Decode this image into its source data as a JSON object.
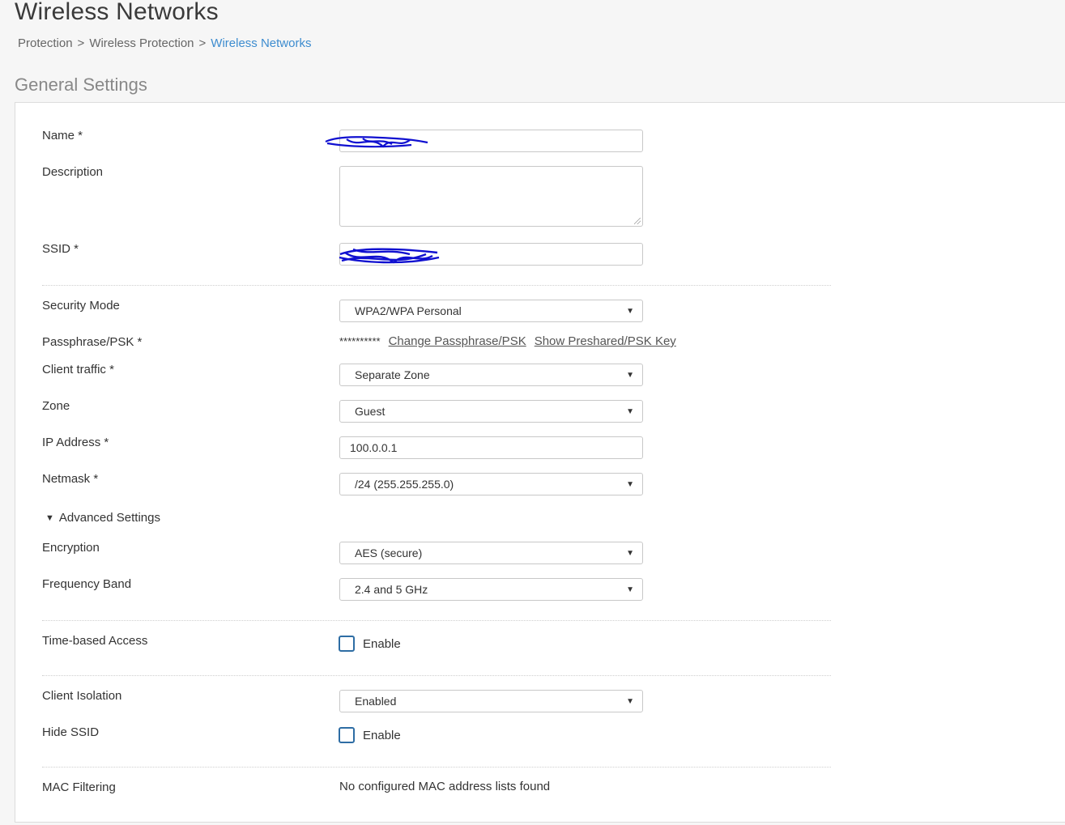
{
  "page": {
    "title": "Wireless Networks",
    "breadcrumb": [
      "Protection",
      "Wireless Protection",
      "Wireless Networks"
    ],
    "breadcrumb_sep": ">",
    "section_title": "General Settings"
  },
  "form": {
    "name": {
      "label": "Name *",
      "value": ""
    },
    "description": {
      "label": "Description",
      "value": ""
    },
    "ssid": {
      "label": "SSID *",
      "value": ""
    },
    "security_mode": {
      "label": "Security Mode",
      "value": "WPA2/WPA Personal"
    },
    "passphrase": {
      "label": "Passphrase/PSK *",
      "mask": "**********",
      "change_link": "Change Passphrase/PSK",
      "show_link": "Show Preshared/PSK Key"
    },
    "client_traffic": {
      "label": "Client traffic *",
      "value": "Separate Zone"
    },
    "zone": {
      "label": "Zone",
      "value": "Guest"
    },
    "ip_address": {
      "label": "IP Address *",
      "value": "100.0.0.1"
    },
    "netmask": {
      "label": "Netmask *",
      "value": "/24 (255.255.255.0)"
    },
    "advanced": {
      "label": "Advanced Settings",
      "toggle": "▼"
    },
    "encryption": {
      "label": "Encryption",
      "value": "AES (secure)"
    },
    "frequency_band": {
      "label": "Frequency Band",
      "value": "2.4 and 5 GHz"
    },
    "time_based_access": {
      "label": "Time-based Access",
      "checkbox_label": "Enable",
      "checked": false
    },
    "client_isolation": {
      "label": "Client Isolation",
      "value": "Enabled"
    },
    "hide_ssid": {
      "label": "Hide SSID",
      "checkbox_label": "Enable",
      "checked": false
    },
    "mac_filtering": {
      "label": "MAC Filtering",
      "value": "No configured MAC address lists found"
    }
  },
  "icons": {
    "select_arrow": "▼"
  },
  "colors": {
    "link": "#3d8ccf",
    "checkbox_border": "#2e6da4",
    "redaction": "#1010d0"
  }
}
